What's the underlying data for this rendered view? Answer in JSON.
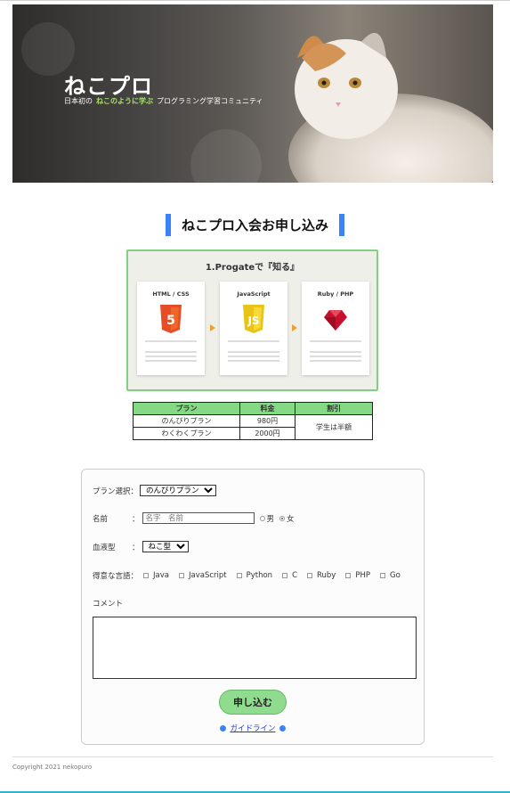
{
  "hero": {
    "title": "ねこプロ",
    "subtitle_pre": "日本初の",
    "subtitle_accent": "ねこのように学ぶ",
    "subtitle_post": "プログラミング学習コミュニティ"
  },
  "section_title": "ねこプロ入会お申し込み",
  "progate": {
    "title": "1.Progateで『知る』",
    "courses": [
      {
        "name": "HTML / CSS",
        "icon": "html5-icon",
        "color": "#e44d26"
      },
      {
        "name": "JavaScript",
        "icon": "js-icon",
        "color": "#f0d01d"
      },
      {
        "name": "Ruby / PHP",
        "icon": "ruby-icon",
        "color": "#cc1a1a"
      }
    ]
  },
  "price_table": {
    "headers": [
      "プラン",
      "料金",
      "割引"
    ],
    "rows": [
      {
        "plan": "のんびりプラン",
        "price": "980円"
      },
      {
        "plan": "わくわくプラン",
        "price": "2000円"
      }
    ],
    "discount": "学生は半額"
  },
  "form": {
    "plan_label": "プラン選択：",
    "plan_selected": "のんびりプラン",
    "name_label": "名前",
    "name_colon": "：",
    "name_placeholder": "名字　名前",
    "gender_male": "男",
    "gender_female": "女",
    "blood_label": "血液型",
    "blood_colon": "：",
    "blood_selected": "ねこ型",
    "lang_label": "得意な言語：",
    "languages": [
      "Java",
      "JavaScript",
      "Python",
      "C",
      "Ruby",
      "PHP",
      "Go"
    ],
    "comment_label": "コメント",
    "submit_label": "申し込む",
    "guide_label": "ガイドライン"
  },
  "footer": {
    "copyright": "Copyright 2021 nekopuro"
  },
  "colors": {
    "accent_blue": "#3b82f6",
    "accent_green": "#85d985",
    "bottom_bar": "#2fb5c8"
  }
}
